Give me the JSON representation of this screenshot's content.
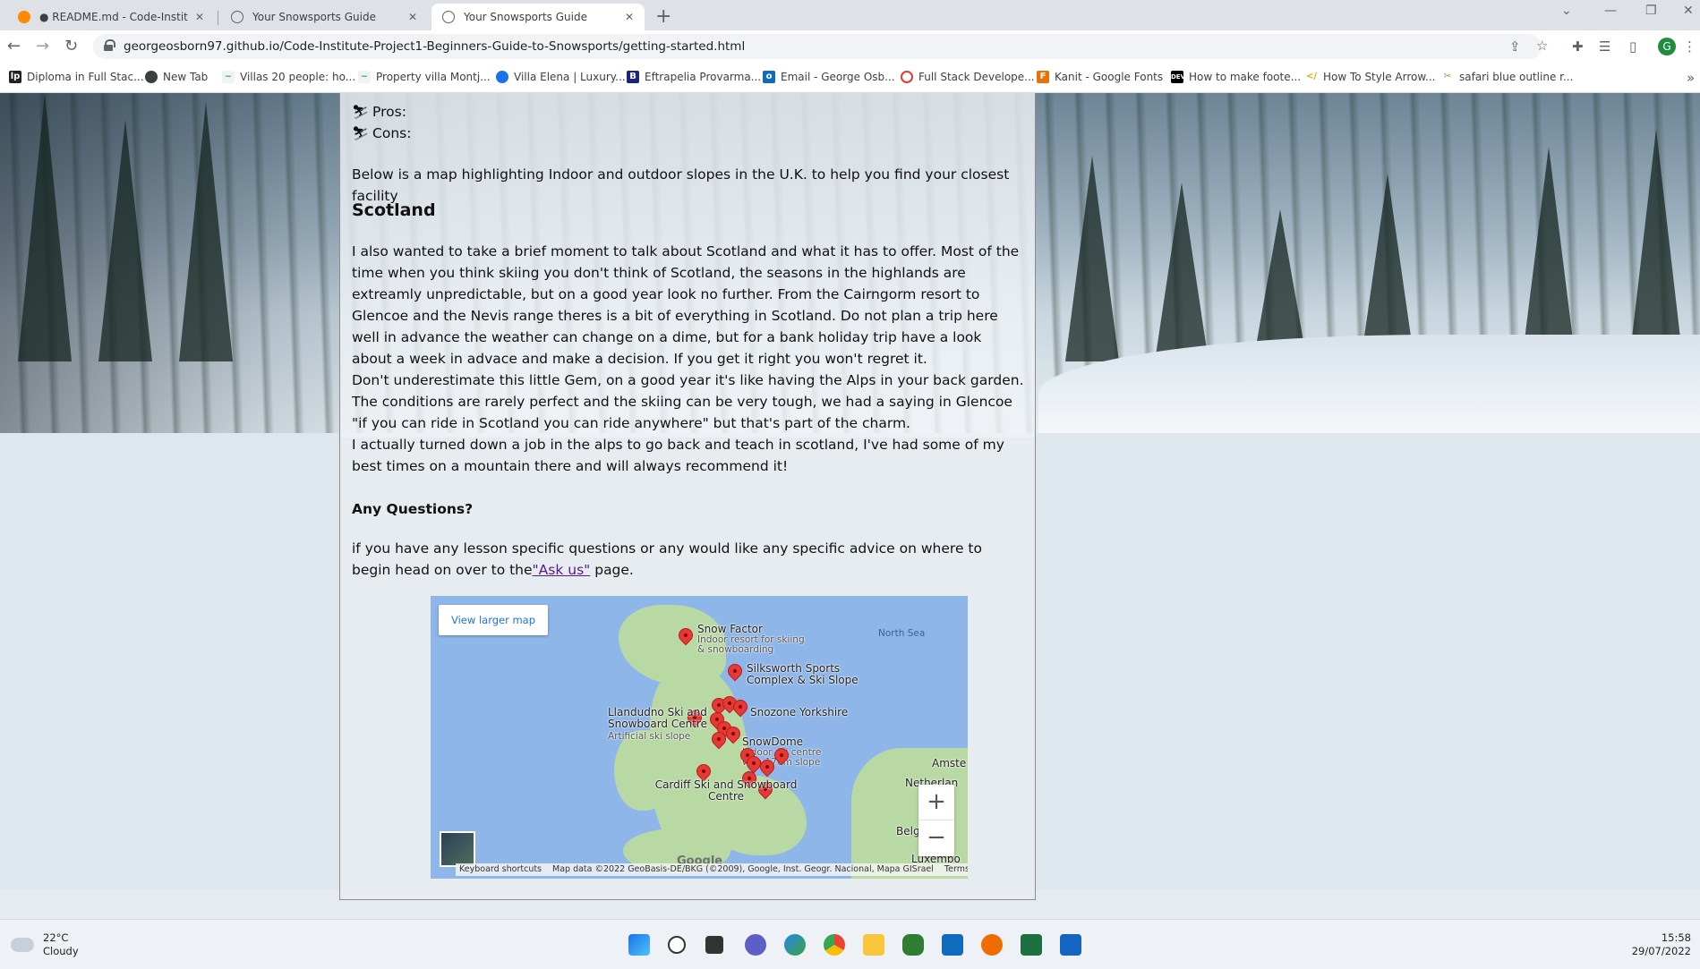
{
  "browser": {
    "tabs": [
      {
        "title": "● README.md - Code-Institute-F",
        "icon": "gitpod-icon",
        "active": false
      },
      {
        "title": "Your Snowsports Guide",
        "icon": "globe-icon",
        "active": false
      },
      {
        "title": "Your Snowsports Guide",
        "icon": "globe-icon",
        "active": true
      }
    ],
    "url": "georgeosborn97.github.io/Code-Institute-Project1-Beginners-Guide-to-Snowsports/getting-started.html",
    "profile_initial": "G",
    "bookmarks": [
      "Diploma in Full Stac...",
      "New Tab",
      "Villas 20 people: ho...",
      "Property villa Montj...",
      "Villa Elena | Luxury...",
      "Eftrapelia Provarma...",
      "Email - George Osb...",
      "Full Stack Develope...",
      "Kanit - Google Fonts",
      "How to make foote...",
      "How To Style Arrow...",
      "safari blue outline r..."
    ]
  },
  "page": {
    "pros_label": "Pros:",
    "cons_label": "Cons:",
    "map_intro": "Below is a map highlighting Indoor and outdoor slopes in the U.K. to help you find your closest facility",
    "scotland_heading": "Scotland",
    "scotland_p1": "I also wanted to take a brief moment to talk about Scotland and what it has to offer. Most of the time when you think skiing you don't think of Scotland, the seasons in the highlands are extreamly unpredictable, but on a good year look no further. From the Cairngorm resort to Glencoe and the Nevis range theres is a bit of everything in Scotland. Do not plan a trip here well in advance the weather can change on a dime, but for a bank holiday trip have a look about a week in advace and make a decision. If you get it right you won't regret it.",
    "scotland_p2": "Don't underestimate this little Gem, on a good year it's like having the Alps in your back garden. The conditions are rarely perfect and the skiing can be very tough, we had a saying in Glencoe \"if you can ride in Scotland you can ride anywhere\" but that's part of the charm.",
    "scotland_p3": "I actually turned down a job in the alps to go back and teach in scotland, I've had some of my best times on a mountain there and will always recommend it!",
    "questions_heading": "Any Questions?",
    "questions_text_before": "if you have any lesson specific questions or any would like any specific advice on where to begin head on over to the",
    "questions_link": "\"Ask us\"",
    "questions_text_after": " page."
  },
  "map": {
    "view_larger": "View larger map",
    "sea_north": "North Sea",
    "places": [
      {
        "name": "Snow Factor",
        "sub": "Indoor resort for skiing & snowboarding"
      },
      {
        "name": "Silksworth Sports Complex & Ski Slope",
        "sub": ""
      },
      {
        "name": "Snozone Yorkshire",
        "sub": ""
      },
      {
        "name": "Llandudno Ski and Snowboard Centre",
        "sub": "Artificial ski slope"
      },
      {
        "name": "SnowDome",
        "sub": "Indoor ski centre with 170m slope"
      },
      {
        "name": "Cardiff Ski and Snowboard Centre",
        "sub": ""
      }
    ],
    "edge_labels": [
      "Amste",
      "Netherlan",
      "Belg",
      "Luxembo"
    ],
    "zoom_in": "+",
    "zoom_out": "−",
    "google": "Google",
    "attribution": [
      "Keyboard shortcuts",
      "Map data ©2022 GeoBasis-DE/BKG (©2009), Google, Inst. Geogr. Nacional, Mapa GISrael",
      "Terms of Use"
    ]
  },
  "taskbar": {
    "temp": "22°C",
    "condition": "Cloudy",
    "time": "15:58",
    "date": "29/07/2022"
  }
}
